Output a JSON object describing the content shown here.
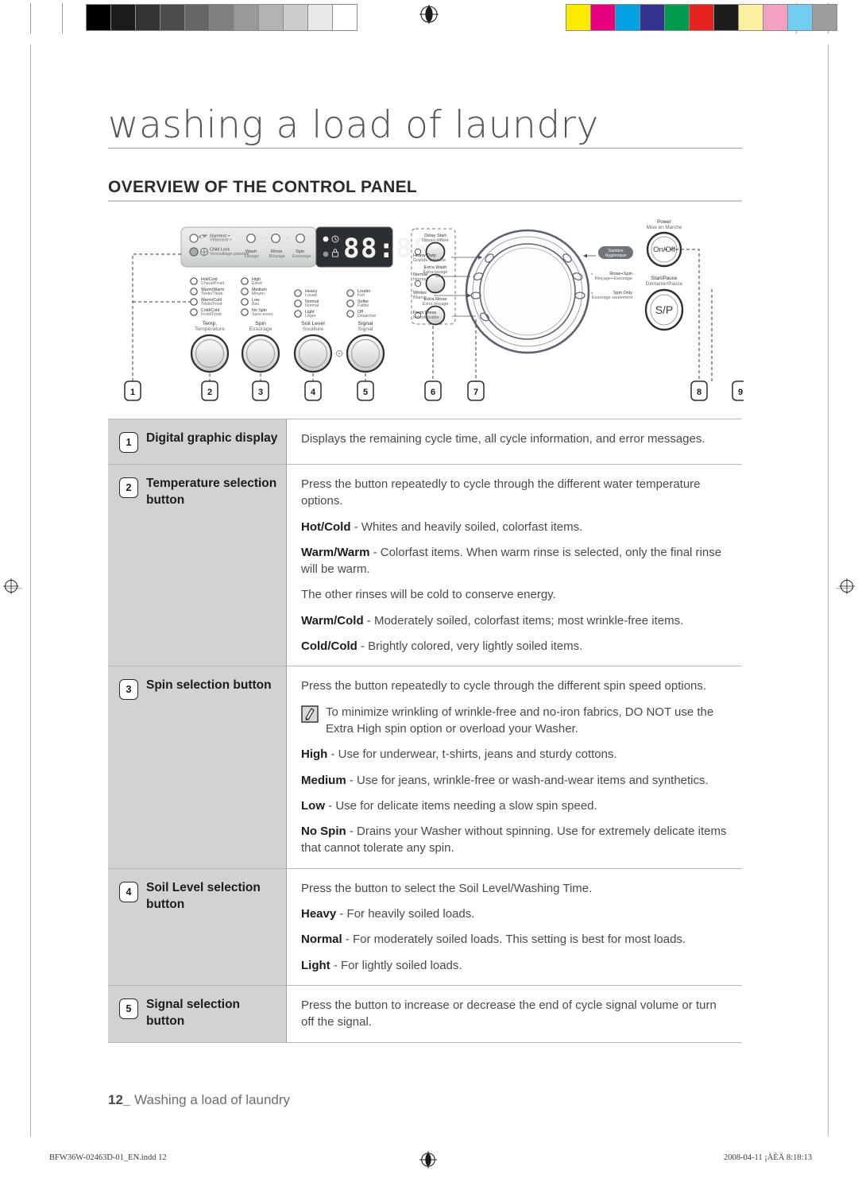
{
  "document": {
    "chapter_title": "washing a load of laundry",
    "section_title": "OVERVIEW OF THE CONTROL PANEL",
    "footer_page_number": "12_",
    "footer_text": "Washing a load of laundry",
    "imprint_left": "BFW36W-02463D-01_EN.indd   12",
    "imprint_right": "2008-04-11   ¡ÀÈÄ 8:18:13"
  },
  "print_bars": {
    "gray_swatches": [
      "#000000",
      "#1c1c1c",
      "#333333",
      "#4d4d4d",
      "#666666",
      "#808080",
      "#999999",
      "#b3b3b3",
      "#cccccc",
      "#e8e8e8",
      "#ffffff"
    ],
    "color_swatches": [
      "#fdec00",
      "#e6007e",
      "#00a0e3",
      "#33348e",
      "#009b4c",
      "#e52421",
      "#1d1d1b",
      "#fbf0a0",
      "#f4a0c0",
      "#73cdf2",
      "#9d9d9c"
    ]
  },
  "control_panel": {
    "status_lamps": [
      {
        "label_en": "Garment +",
        "label_fr": "Vêtement +",
        "icon": "garment-icon"
      },
      {
        "label_en": "Child Lock",
        "label_fr": "Verrouillage parental",
        "icon": "child-lock-icon"
      }
    ],
    "progress_lamps": [
      {
        "label_en": "Wash",
        "label_fr": "Lavage"
      },
      {
        "label_en": "Rinse",
        "label_fr": "Rinçage"
      },
      {
        "label_en": "Spin",
        "label_fr": "Essorage"
      }
    ],
    "display_value": "88:88",
    "display_icons": [
      "clock-icon",
      "lock-icon"
    ],
    "temperature": {
      "title_en": "Temp.",
      "title_fr": "Température",
      "options": [
        {
          "en": "Hot/Cold",
          "fr": "Chaud/Froid"
        },
        {
          "en": "Warm/Warm",
          "fr": "Tiède/Tiède"
        },
        {
          "en": "Warm/Cold",
          "fr": "Tiède/Froid"
        },
        {
          "en": "Cold/Cold",
          "fr": "Froid/Froid"
        }
      ]
    },
    "spin": {
      "title_en": "Spin",
      "title_fr": "Essorage",
      "options": [
        {
          "en": "High",
          "fr": "Élevé"
        },
        {
          "en": "Medium",
          "fr": "Moyen"
        },
        {
          "en": "Low",
          "fr": "Bas"
        },
        {
          "en": "No Spin",
          "fr": "Sans essor"
        }
      ]
    },
    "soil_level": {
      "title_en": "Soil Level",
      "title_fr": "Souillure",
      "options": [
        {
          "en": "Heavy",
          "fr": "Lourd"
        },
        {
          "en": "Normal",
          "fr": "Normal"
        },
        {
          "en": "Light",
          "fr": "Léger"
        }
      ]
    },
    "signal": {
      "title_en": "Signal",
      "title_fr": "Signal",
      "options": [
        {
          "en": "Louder",
          "fr": "Fort"
        },
        {
          "en": "Softer",
          "fr": "Faible"
        },
        {
          "en": "Off",
          "fr": "Désactivé"
        }
      ]
    },
    "option_buttons": [
      {
        "en": "Delay Start",
        "fr": "Départ différé"
      },
      {
        "en": "Extra Wash",
        "fr": "Extra lavage"
      },
      {
        "en": "Extra Rinse",
        "fr": "Extra rinçage"
      }
    ],
    "cycle_selector_left": [
      {
        "en": "Heavy Duty",
        "fr": "Grande capacité"
      },
      {
        "en": "Normal",
        "fr": "Normal"
      },
      {
        "en": "Whites",
        "fr": "Blancs"
      },
      {
        "en": "Perm Press",
        "fr": "Indéplissable"
      }
    ],
    "cycle_selector_right": [
      {
        "en": "Sanitize",
        "fr": "Hygiénique",
        "badge": true
      },
      {
        "en": "Rinse+Spin",
        "fr": "Rinçage+Essorage",
        "asterisk": "*"
      },
      {
        "en": "Spin Only",
        "fr": "Essorage seulement",
        "asterisk": "*"
      }
    ],
    "power_button": {
      "title_en": "Power",
      "title_fr": "Mise en Marche",
      "face": "On/Off"
    },
    "start_pause_button": {
      "title_en": "Start/Pause",
      "title_fr": "Démarrer/Pause",
      "face": "S/P"
    },
    "callouts": [
      "1",
      "2",
      "3",
      "4",
      "5",
      "6",
      "7",
      "8",
      "9"
    ]
  },
  "table": {
    "rows": [
      {
        "number": "1",
        "label": "Digital graphic display",
        "paragraphs": [
          {
            "text": "Displays the remaining cycle time, all cycle information, and error messages."
          }
        ]
      },
      {
        "number": "2",
        "label": "Temperature selection button",
        "paragraphs": [
          {
            "text": "Press the button repeatedly to cycle through the different water temperature options."
          },
          {
            "bold": "Hot/Cold",
            "text": " - Whites and heavily soiled, colorfast items."
          },
          {
            "bold": "Warm/Warm",
            "text": " - Colorfast items. When warm rinse is selected, only the final rinse will be warm."
          },
          {
            "text": "The other rinses will be cold to conserve energy."
          },
          {
            "bold": "Warm/Cold",
            "text": " - Moderately soiled, colorfast items; most wrinkle-free items."
          },
          {
            "bold": "Cold/Cold",
            "text": " - Brightly colored, very lightly soiled items."
          }
        ]
      },
      {
        "number": "3",
        "label": "Spin selection button",
        "paragraphs": [
          {
            "text": "Press the button repeatedly to cycle through the different spin speed options."
          },
          {
            "note": true,
            "text": "To minimize wrinkling of wrinkle-free and no-iron fabrics, DO NOT use the Extra High spin option or overload your Washer."
          },
          {
            "bold": "High",
            "text": " - Use for underwear, t-shirts, jeans and sturdy cottons."
          },
          {
            "bold": "Medium",
            "text": " - Use for jeans, wrinkle-free or wash-and-wear items and synthetics."
          },
          {
            "bold": "Low",
            "text": " - Use for delicate items needing a slow spin speed."
          },
          {
            "bold": "No Spin",
            "text": " - Drains your Washer without spinning. Use for extremely delicate items that cannot tolerate any spin."
          }
        ]
      },
      {
        "number": "4",
        "label": "Soil Level selection button",
        "paragraphs": [
          {
            "text": "Press the button to select the Soil Level/Washing Time."
          },
          {
            "bold": "Heavy",
            "text": " - For heavily soiled loads."
          },
          {
            "bold": "Normal",
            "text": " - For moderately soiled loads. This setting is best for most loads."
          },
          {
            "bold": "Light",
            "text": " - For lightly soiled loads."
          }
        ]
      },
      {
        "number": "5",
        "label": "Signal selection button",
        "paragraphs": [
          {
            "text": "Press the button to increase or decrease the end of cycle signal volume or turn off the signal."
          }
        ]
      }
    ]
  },
  "colors": {
    "label_cell_bg": "#d2d2d2",
    "rule": "#b8b8b8",
    "text": "#4a4a4a",
    "heading": "#2b2b2b"
  }
}
